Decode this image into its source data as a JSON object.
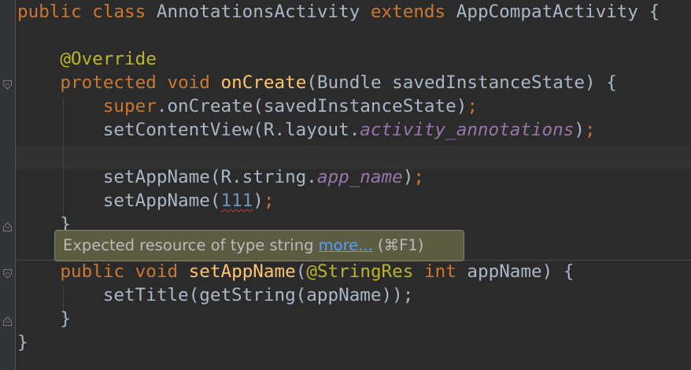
{
  "editor": {
    "tooltip": {
      "message": "Expected resource of type string",
      "link": "more...",
      "shortcut": "(⌘F1)"
    },
    "tokens": {
      "public": "public",
      "class": "class",
      "class_name": "AnnotationsActivity",
      "extends": "extends",
      "super_class": "AppCompatActivity",
      "brace_open": "{",
      "brace_close": "}",
      "override": "@Override",
      "protected": "protected",
      "void": "void",
      "on_create": "onCreate",
      "on_create_params": "(Bundle savedInstanceState)",
      "super": "super",
      "super_call": ".onCreate(savedInstanceState)",
      "semicolon": ";",
      "set_content_view": "setContentView(R.layout.",
      "activity_annotations": "activity_annotations",
      "close_paren": ")",
      "set_app_name_rstring": "setAppName(R.string.",
      "app_name": "app_name",
      "set_app_name_open": "setAppName(",
      "num_111": "111",
      "set_app_name": "setAppName",
      "open_paren": "(",
      "string_res": "@StringRes",
      "int": "int",
      "param_app_name": "appName)",
      "set_title": "setTitle(getString(appName));"
    }
  }
}
